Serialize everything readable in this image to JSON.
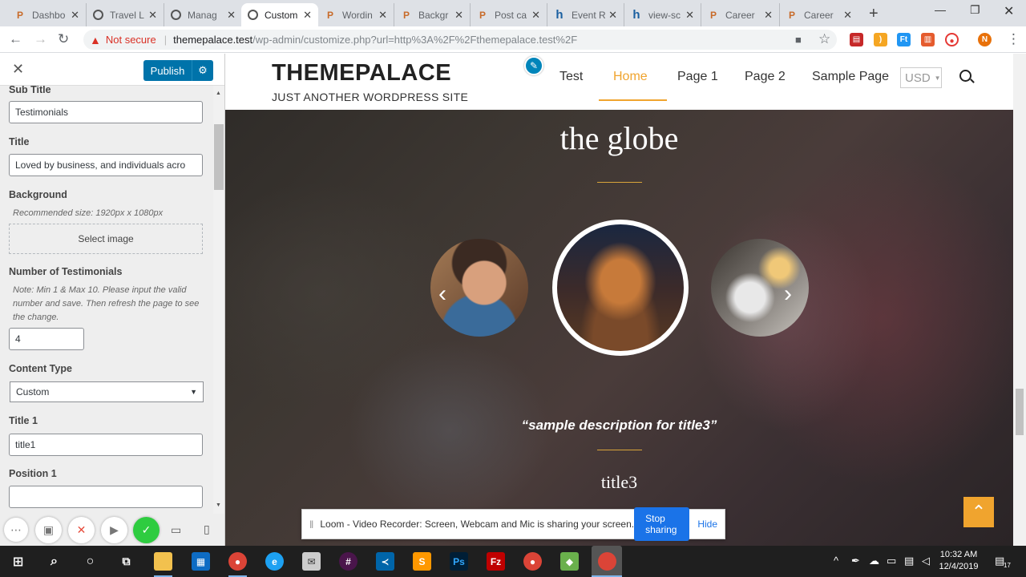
{
  "browser": {
    "tabs": [
      {
        "title": "Dashbo",
        "icon": "p-favicon"
      },
      {
        "title": "Travel L",
        "icon": "globe-favicon"
      },
      {
        "title": "Manag",
        "icon": "globe-favicon"
      },
      {
        "title": "Custom",
        "icon": "globe-favicon",
        "active": true
      },
      {
        "title": "Wordin",
        "icon": "p-favicon"
      },
      {
        "title": "Backgr",
        "icon": "p-favicon"
      },
      {
        "title": "Post ca",
        "icon": "p-favicon"
      },
      {
        "title": "Event R",
        "icon": "h-favicon"
      },
      {
        "title": "view-sc",
        "icon": "h-favicon"
      },
      {
        "title": "Career",
        "icon": "p-favicon"
      },
      {
        "title": "Career",
        "icon": "p-favicon"
      }
    ],
    "security_label": "Not secure",
    "url_host": "themepalace.test",
    "url_path": "/wp-admin/customize.php?url=http%3A%2F%2Fthemepalace.test%2F",
    "profile_initial": "N"
  },
  "customizer": {
    "publish_label": "Publish",
    "fields": {
      "subtitle_label": "Sub Title",
      "subtitle_value": "Testimonials",
      "title_label": "Title",
      "title_value": "Loved by business, and individuals acro",
      "background_label": "Background",
      "background_note": "Recommended size: 1920px x 1080px",
      "select_image_label": "Select image",
      "number_label": "Number of Testimonials",
      "number_note": "Note: Min 1 & Max 10. Please input the valid number and save. Then refresh the page to see the change.",
      "number_value": "4",
      "content_type_label": "Content Type",
      "content_type_value": "Custom",
      "title1_label": "Title 1",
      "title1_value": "title1",
      "position1_label": "Position 1",
      "position1_value": ""
    }
  },
  "site": {
    "title": "THEMEPALACE",
    "tagline": "JUST ANOTHER WORDPRESS SITE",
    "menu": [
      "Test",
      "Home",
      "Page 1",
      "Page 2",
      "Sample Page"
    ],
    "active_menu": "Home",
    "currency": "USD",
    "hero_heading": "the globe",
    "testimonial_quote": "“sample description for title3”",
    "testimonial_name": "title3",
    "accent_color": "#f0a42e"
  },
  "loom": {
    "message": "Loom - Video Recorder: Screen, Webcam and Mic is sharing your screen.",
    "stop_label": "Stop sharing",
    "hide_label": "Hide"
  },
  "taskbar": {
    "time": "10:32 AM",
    "date": "12/4/2019",
    "notification_count": "17"
  }
}
